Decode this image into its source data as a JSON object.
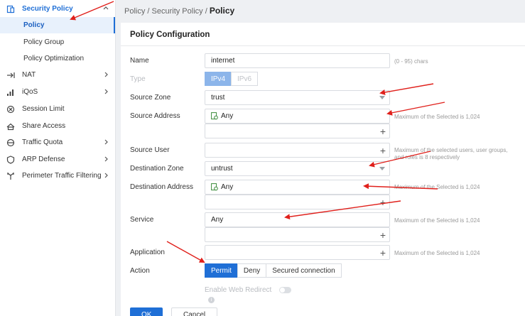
{
  "sidebar": {
    "items": [
      {
        "label": "Security Policy",
        "icon": "security-policy-icon"
      },
      {
        "label": "NAT",
        "icon": "nat-icon"
      },
      {
        "label": "iQoS",
        "icon": "iqos-icon"
      },
      {
        "label": "Session Limit",
        "icon": "session-limit-icon"
      },
      {
        "label": "Share Access",
        "icon": "share-access-icon"
      },
      {
        "label": "Traffic Quota",
        "icon": "traffic-quota-icon"
      },
      {
        "label": "ARP Defense",
        "icon": "arp-defense-icon"
      },
      {
        "label": "Perimeter Traffic Filtering",
        "icon": "perimeter-filter-icon"
      }
    ],
    "sub": [
      {
        "label": "Policy"
      },
      {
        "label": "Policy Group"
      },
      {
        "label": "Policy Optimization"
      }
    ]
  },
  "breadcrumb": {
    "part1": "Policy",
    "sep1": " / ",
    "part2": "Security Policy",
    "sep2": " / ",
    "current": "Policy"
  },
  "card": {
    "title": "Policy Configuration"
  },
  "form": {
    "name": {
      "label": "Name",
      "value": "internet",
      "hint": "(0 - 95) chars"
    },
    "type": {
      "label": "Type",
      "options": [
        "IPv4",
        "IPv6"
      ],
      "selected": "IPv4"
    },
    "source_zone": {
      "label": "Source Zone",
      "value": "trust"
    },
    "source_address": {
      "label": "Source Address",
      "value": "Any",
      "hint": "Maximum of the Selected is 1,024"
    },
    "source_user": {
      "label": "Source User",
      "hint1": "Maximum of the selected users, user groups,",
      "hint2": "and roles is 8 respectively"
    },
    "destination_zone": {
      "label": "Destination Zone",
      "value": "untrust"
    },
    "destination_address": {
      "label": "Destination Address",
      "value": "Any",
      "hint": "Maximum of the Selected is 1,024"
    },
    "service": {
      "label": "Service",
      "value": "Any",
      "hint": "Maximum of the Selected is 1,024"
    },
    "application": {
      "label": "Application",
      "hint": "Maximum of the Selected is 1,024"
    },
    "action": {
      "label": "Action",
      "options": [
        "Permit",
        "Deny",
        "Secured connection"
      ],
      "selected": "Permit"
    },
    "web_redirect": {
      "label": "Enable Web Redirect",
      "enabled": false
    }
  },
  "buttons": {
    "ok": "OK",
    "cancel": "Cancel"
  },
  "colors": {
    "accent": "#1f6fd6",
    "annotation": "#e0201b"
  },
  "plus_glyph": "+",
  "info_glyph": "i"
}
